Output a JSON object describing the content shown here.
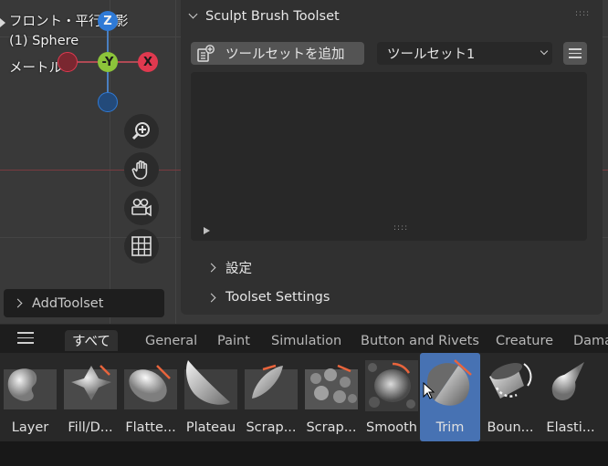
{
  "viewport": {
    "view_title": "フロント・平行投影",
    "object_name": "(1) Sphere",
    "units_label": "メートル",
    "gizmo": {
      "z_label": "Z",
      "neg_y_label": "-Y",
      "x_label": "X"
    },
    "nav_buttons": [
      "zoom-icon",
      "hand-pan-icon",
      "camera-icon",
      "grid-icon"
    ]
  },
  "panel": {
    "title": "Sculpt Brush Toolset",
    "add_button_label": "ツールセットを追加",
    "toolset_select_value": "ツールセット1",
    "sections": {
      "settings": "設定",
      "toolset_settings": "Toolset Settings"
    }
  },
  "add_toolset_label": "AddToolset",
  "shelf": {
    "tabs": [
      "すべて",
      "General",
      "Paint",
      "Simulation",
      "Button and Rivets",
      "Creature",
      "Dama"
    ],
    "active_tab": "すべて",
    "items": [
      "Layer",
      "Fill/D...",
      "Flatte...",
      "Plateau",
      "Scrap...",
      "Scrap...",
      "Smooth",
      "Trim",
      "Boun...",
      "Elasti..."
    ],
    "selected_item": "Trim"
  },
  "colors": {
    "accent_selected": "#4772b3",
    "axis_x": "#e0394f",
    "axis_y": "#8cc43a",
    "axis_z": "#2f7ad6"
  }
}
